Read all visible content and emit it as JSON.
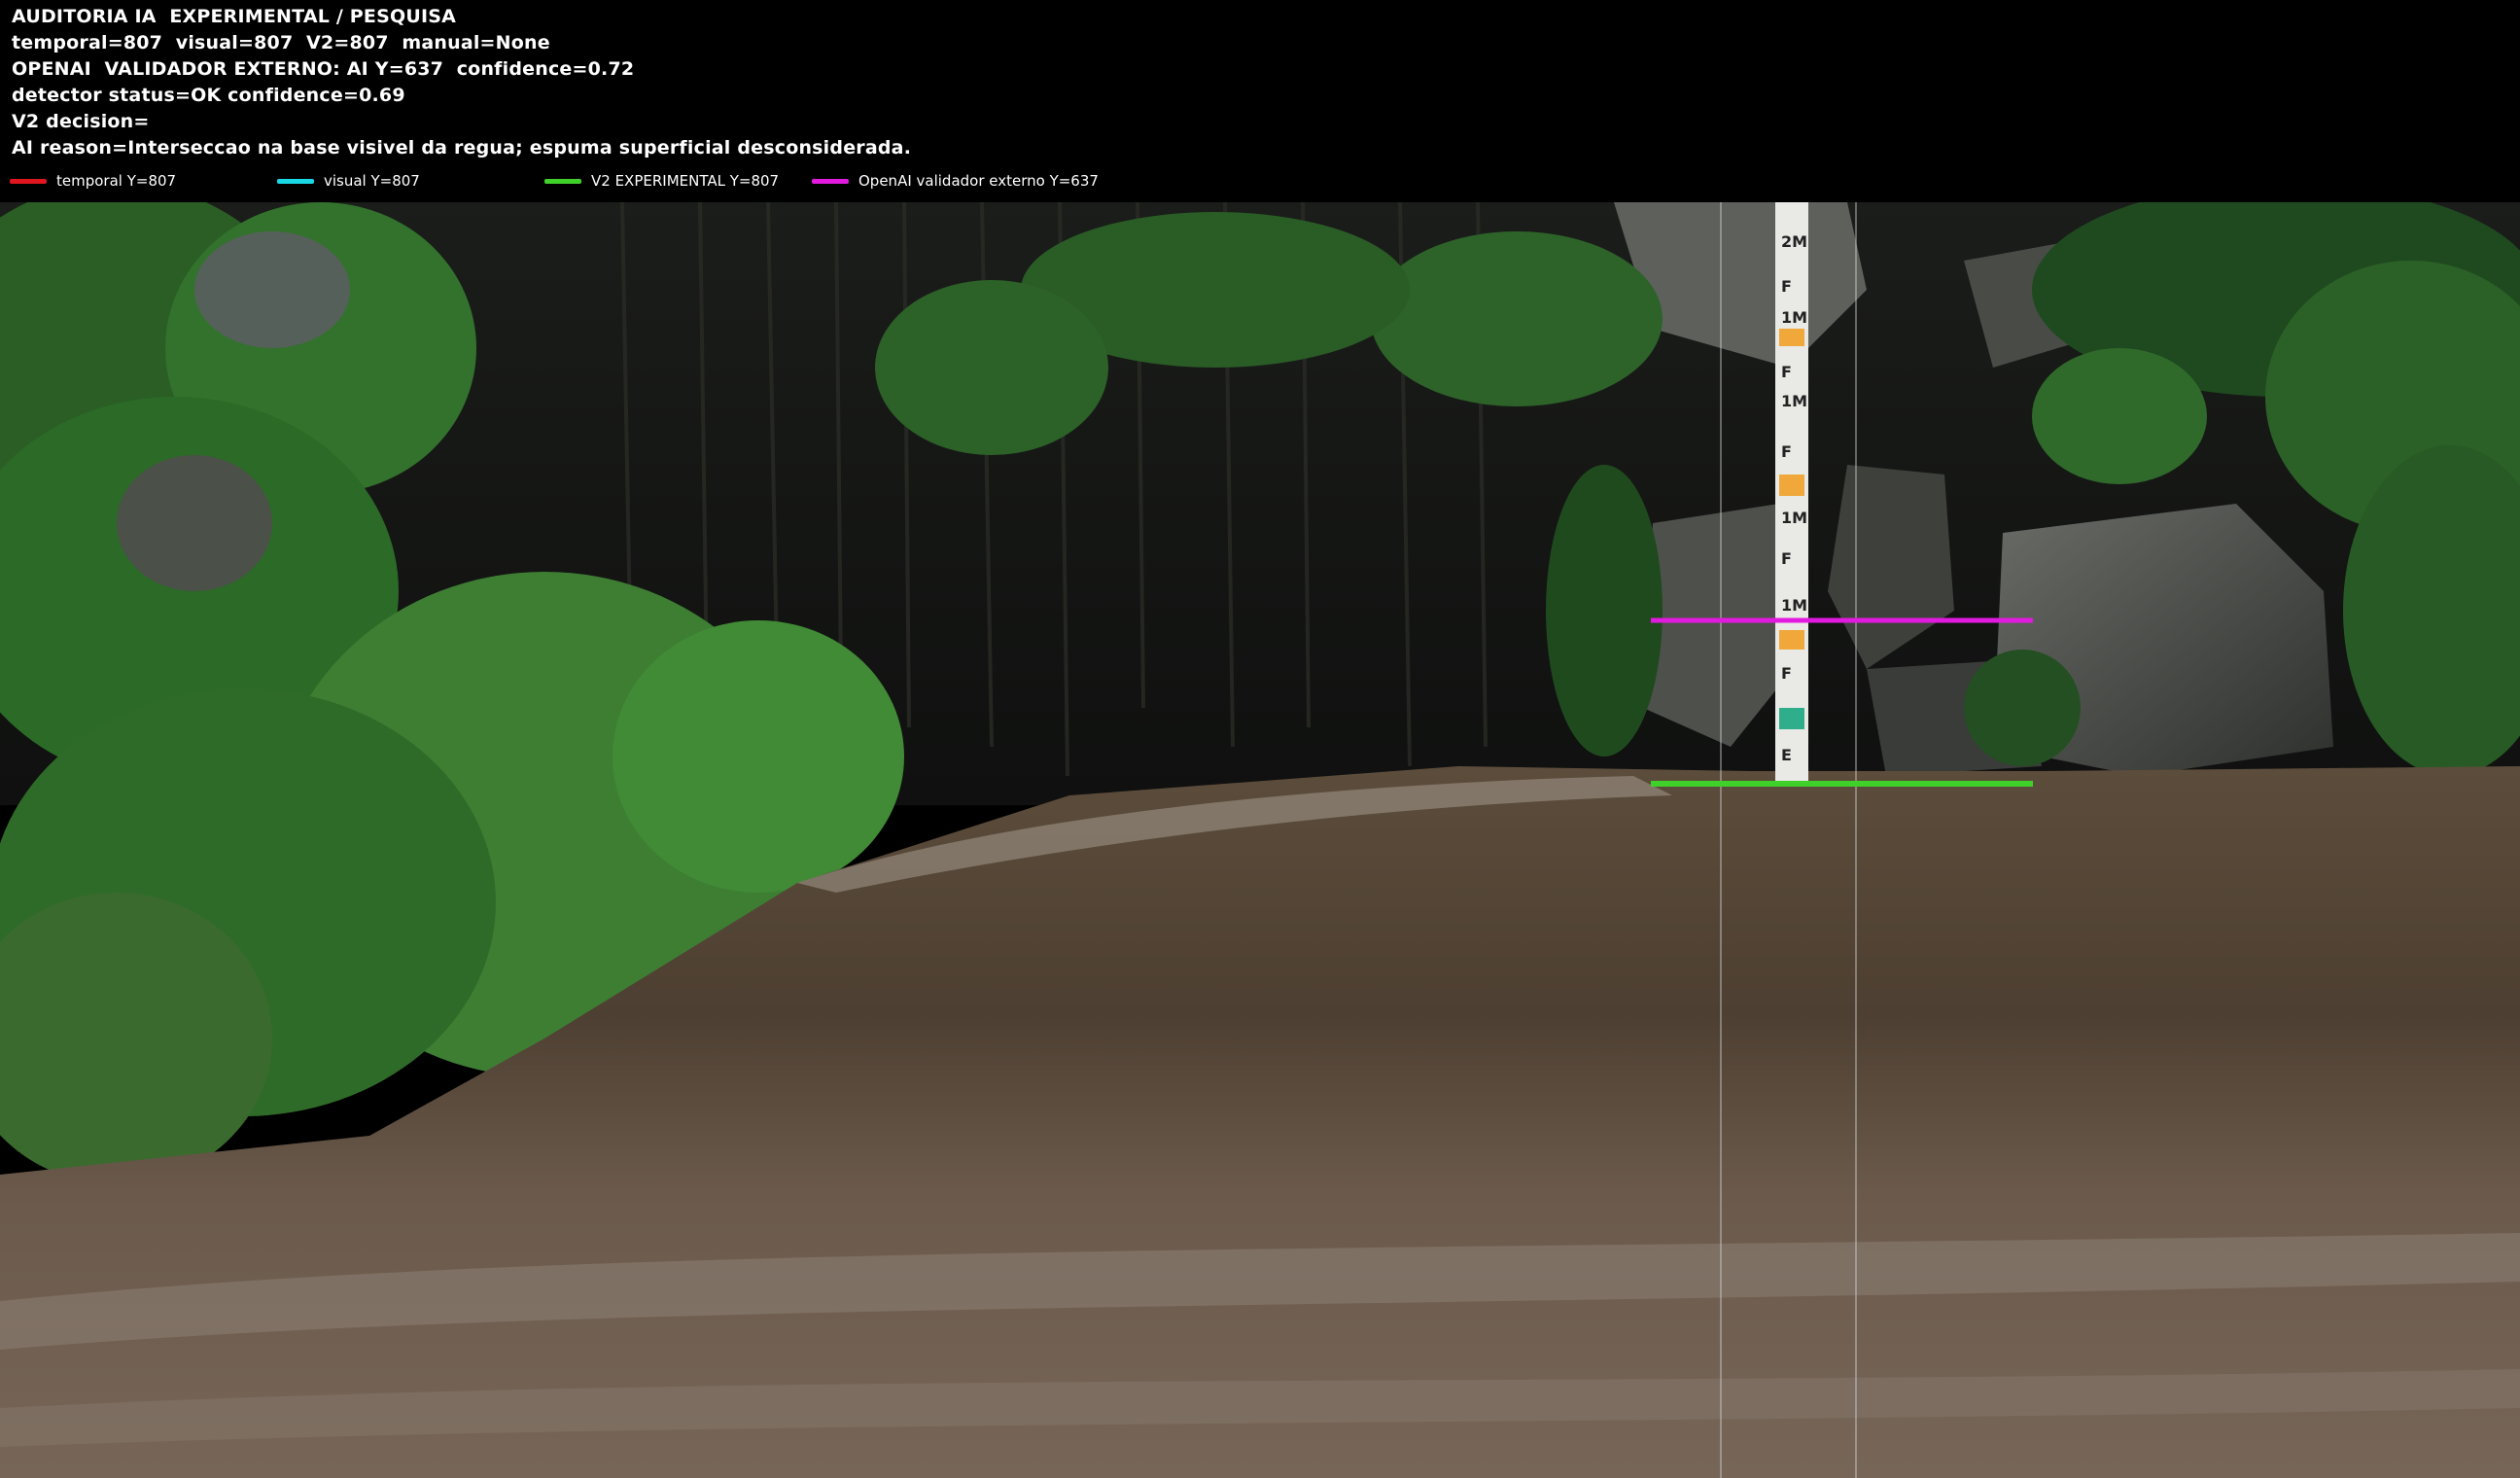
{
  "header": {
    "lines": [
      "AUDITORIA IA  EXPERIMENTAL / PESQUISA",
      "temporal=807  visual=807  V2=807  manual=None",
      "OPENAI  VALIDADOR EXTERNO: AI Y=637  confidence=0.72",
      "detector status=OK confidence=0.69",
      "V2 decision=",
      "AI reason=Interseccao na base visivel da regua; espuma superficial desconsiderada."
    ]
  },
  "legend": [
    {
      "label": "temporal Y=807",
      "color": "#e0161e"
    },
    {
      "label": "visual Y=807",
      "color": "#19d8e6"
    },
    {
      "label": "V2 EXPERIMENTAL Y=807",
      "color": "#3fd12a"
    },
    {
      "label": "OpenAI validador externo Y=637",
      "color": "#e21ae0"
    }
  ],
  "overlay_colors": {
    "openai_line": "#e21ae0",
    "v2_line": "#3fd12a",
    "guide_line": "#d8d8d8"
  },
  "gauge": {
    "marks": [
      "2M",
      "F",
      "1M",
      "F",
      "1M",
      "F",
      "1M",
      "F",
      "1M",
      "F",
      "E"
    ]
  }
}
